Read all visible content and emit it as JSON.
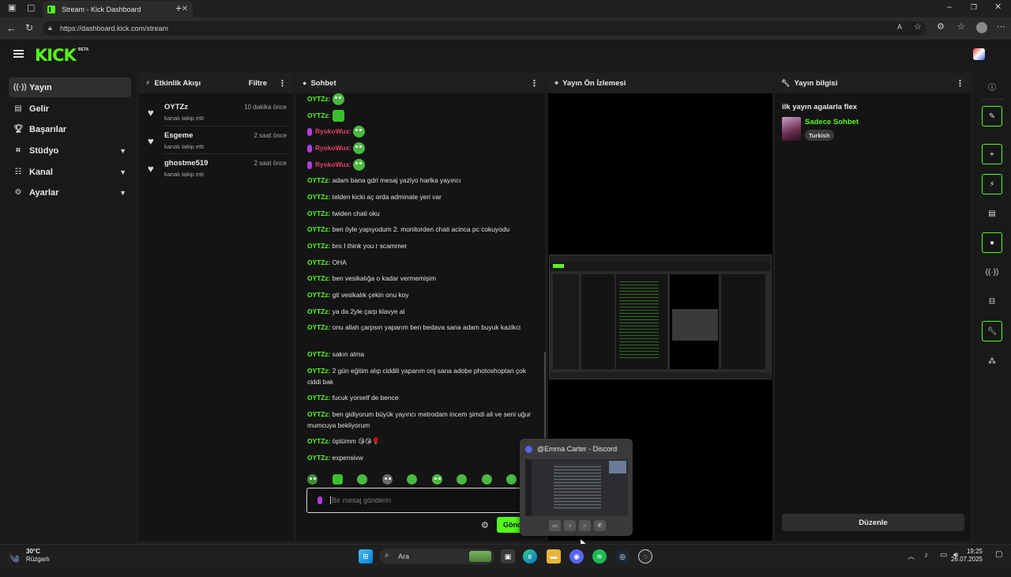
{
  "browser": {
    "tab_title": "Stream - Kick Dashboard",
    "url": "https://dashboard.kick.com/stream"
  },
  "brand": {
    "logo": "KICK",
    "badge": "BETA",
    "accent": "#53fc18"
  },
  "nav": {
    "items": [
      {
        "label": "Yayın",
        "icon": "broadcast-icon",
        "active": true
      },
      {
        "label": "Gelir",
        "icon": "revenue-icon"
      },
      {
        "label": "Başarılar",
        "icon": "trophy-icon"
      },
      {
        "label": "Stüdyo",
        "icon": "studio-icon",
        "expandable": true
      },
      {
        "label": "Kanal",
        "icon": "channel-icon",
        "expandable": true
      },
      {
        "label": "Ayarlar",
        "icon": "gear-icon",
        "expandable": true
      }
    ]
  },
  "activity": {
    "title": "Etkinlik Akışı",
    "filter_label": "Filtre",
    "items": [
      {
        "user": "OYTZz",
        "desc": "kanalı takip etti",
        "time": "10 dakika önce"
      },
      {
        "user": "Esgeme",
        "desc": "kanalı takip etti",
        "time": "2 saat önce"
      },
      {
        "user": "ghostme519",
        "desc": "kanalı takip etti",
        "time": "2 saat önce"
      }
    ]
  },
  "chat": {
    "title": "Sohbet",
    "user_main": "OYTZz",
    "user_other": "RyokoWux",
    "colon": ":",
    "messages": [
      "adam bana gdri mesaj yaziyo harika yayıncı",
      "telden kicki aç orda adminate yeri var",
      "twiden chati oku",
      "ben öyle yapıyodum 2. monitorden chati acinca pc cokuyodu",
      "bro I think you r scammer",
      "OHA",
      "ben vesikalığa o kadar vermemişim",
      "git vesikalık çekin onu koy",
      "ya da 2yle çarp klavye al",
      "onu allah çarpsın yaparım ben bedava sana adam buyuk kazikci",
      "sakın alma",
      "2 gün eğitim alıp ciddili yaparım onj sana adobe photoshoptan çok ciddi bak",
      "fucuk yorself de bence",
      "ben gidiyorum büyük yayıncı metrodam incem şimdi ali ve seni uğur mumcuya bekliyorum",
      "öptümm 😘😘🌹",
      "expensivw"
    ],
    "input_placeholder": "Bir mesaj gönderin",
    "send_label": "Gönder"
  },
  "preview": {
    "title": "Yayın Ön İzlemesi"
  },
  "stream_info": {
    "title": "Yayın bilgisi",
    "stream_title": "ilk yayın agalarla flex",
    "category": "Sadece Sohbet",
    "tag": "Turkish",
    "edit_label": "Düzenle"
  },
  "discord_popup": {
    "title": "@Emma Carter - Discord"
  },
  "taskbar": {
    "weather_temp": "30°C",
    "weather_desc": "Rüzgarlı",
    "search_label": "Ara",
    "time": "19:25",
    "date": "26.07.2025"
  }
}
